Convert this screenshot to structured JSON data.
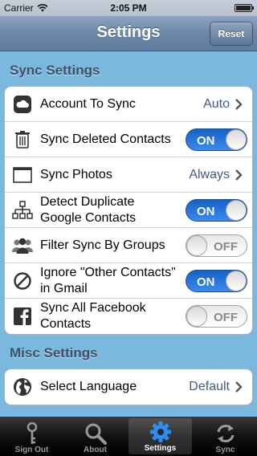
{
  "status_bar": {
    "carrier": "Carrier",
    "time": "2:05 PM"
  },
  "nav": {
    "title": "Settings",
    "reset_label": "Reset"
  },
  "sync_section": {
    "title": "Sync Settings",
    "rows": [
      {
        "label": "Account To Sync",
        "value": "Auto"
      },
      {
        "label": "Sync Deleted Contacts",
        "toggle": "ON"
      },
      {
        "label": "Sync Photos",
        "value": "Always"
      },
      {
        "label_line1": "Detect Duplicate",
        "label_line2": "Google Contacts",
        "toggle": "ON"
      },
      {
        "label": "Filter Sync By Groups",
        "toggle": "OFF"
      },
      {
        "label_line1": "Ignore \"Other Contacts\"",
        "label_line2": "in Gmail",
        "toggle": "ON"
      },
      {
        "label_line1": "Sync All Facebook",
        "label_line2": "Contacts",
        "toggle": "OFF"
      }
    ]
  },
  "misc_section": {
    "title": "Misc Settings",
    "rows": [
      {
        "label": "Select Language",
        "value": "Default"
      }
    ]
  },
  "tabs": [
    {
      "label": "Sign Out",
      "icon": "key-icon"
    },
    {
      "label": "About",
      "icon": "magnifier-icon"
    },
    {
      "label": "Settings",
      "icon": "gear-icon",
      "active": true
    },
    {
      "label": "Sync",
      "icon": "sync-icon"
    }
  ],
  "colors": {
    "toggle_on": "#1f6fd8",
    "nav_bar": "#6e87a8",
    "background": "#7ab8de",
    "value_text": "#3d5b8a"
  }
}
